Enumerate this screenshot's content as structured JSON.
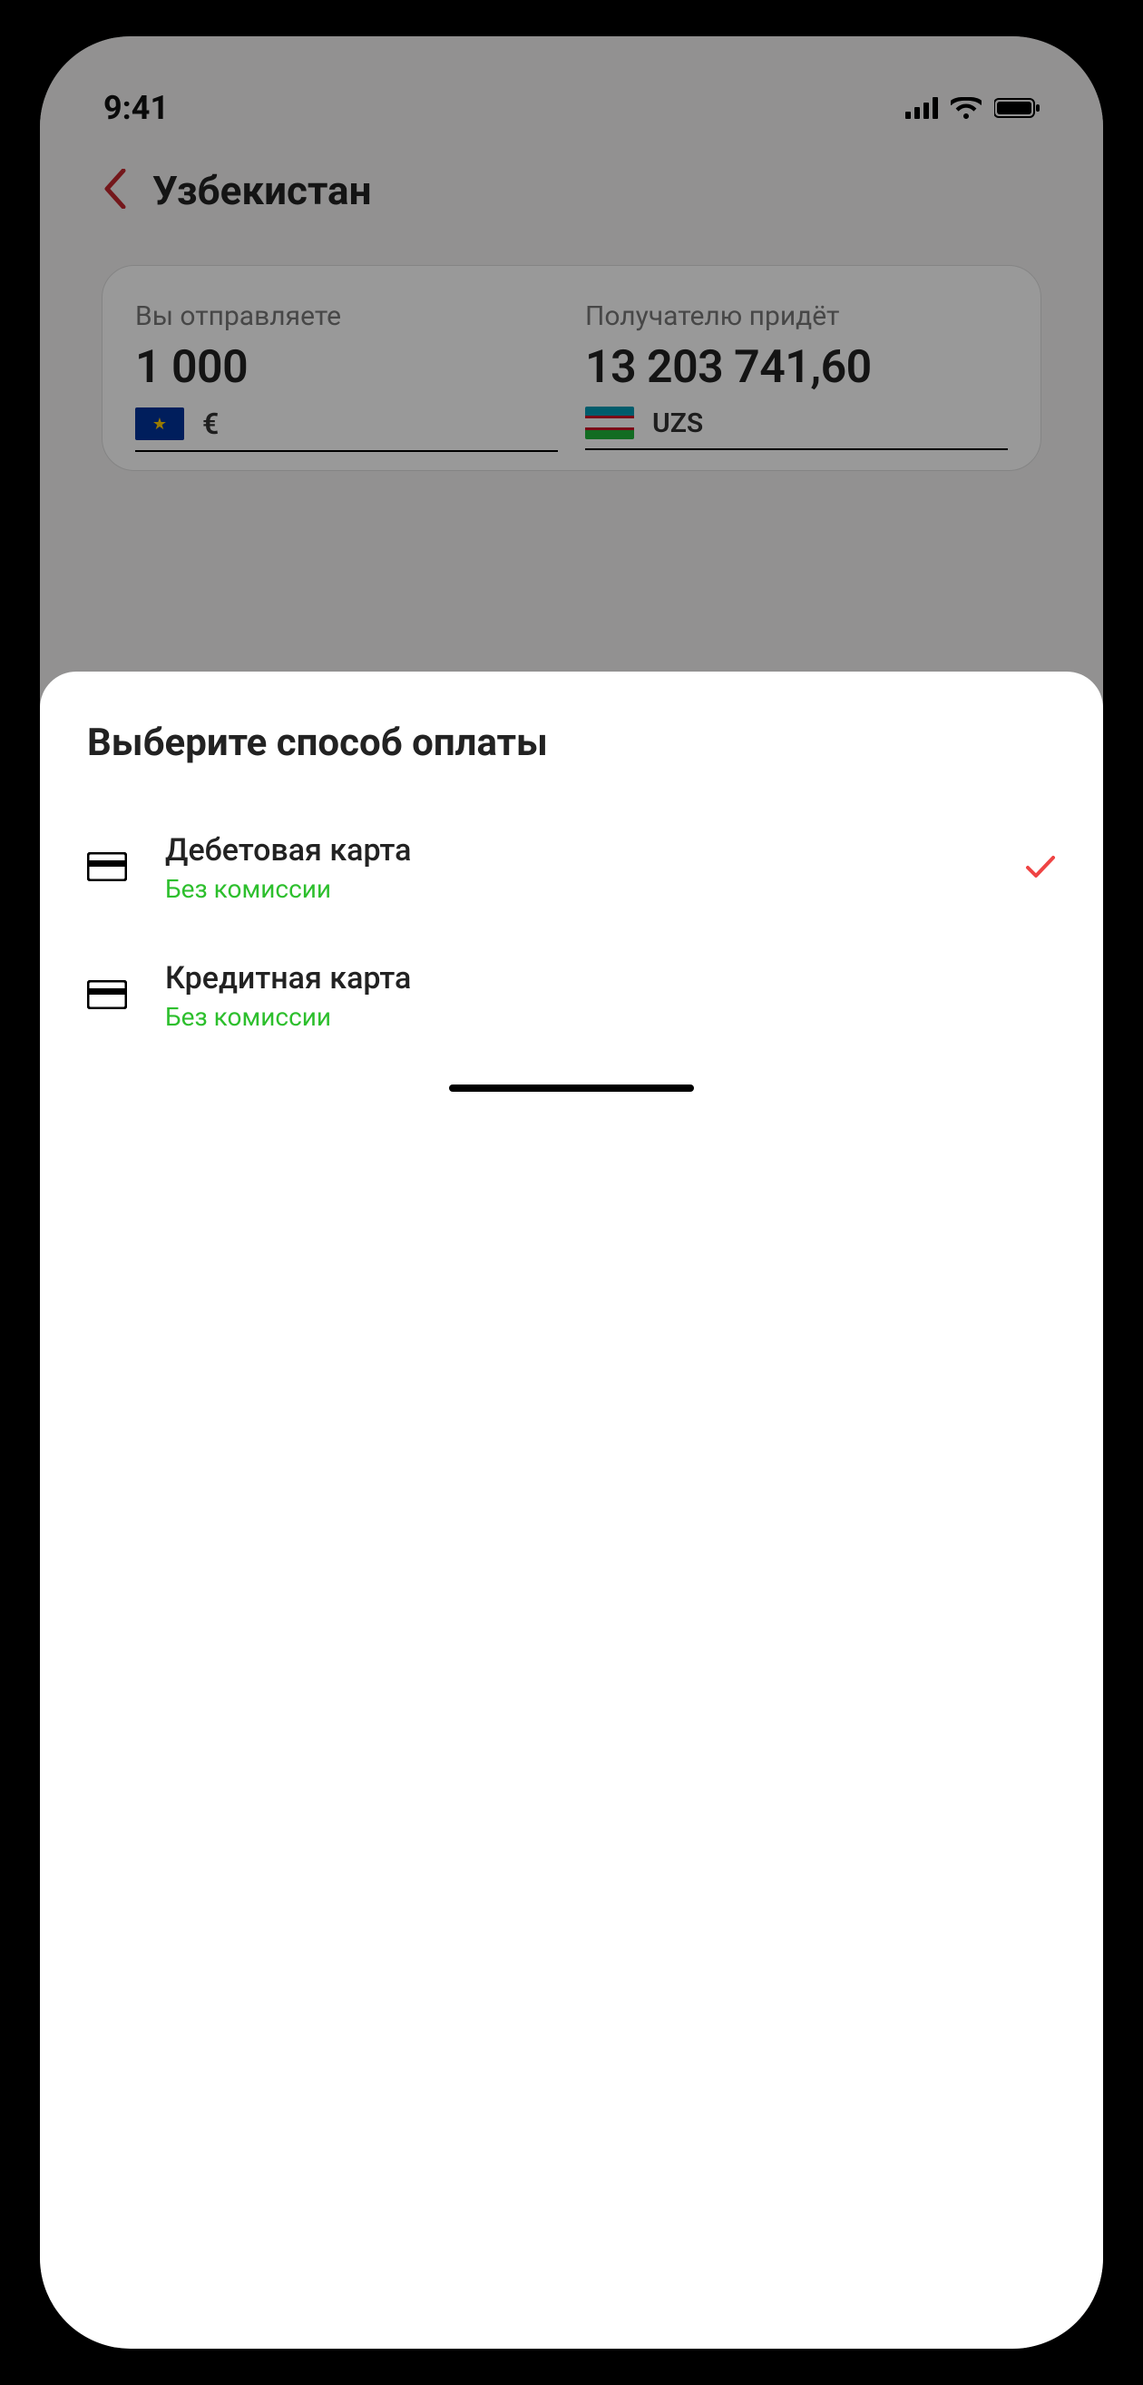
{
  "status": {
    "time": "9:41"
  },
  "nav": {
    "title": "Узбекистан"
  },
  "send": {
    "label": "Вы отправляете",
    "amount": "1 000",
    "currencySymbol": "€"
  },
  "receive": {
    "label": "Получателю придёт",
    "amount": "13 203 741,60",
    "currencyCode": "UZS"
  },
  "sheet": {
    "title": "Выберите способ оплаты",
    "options": [
      {
        "title": "Дебетовая карта",
        "subtitle": "Без комиссии",
        "selected": true
      },
      {
        "title": "Кредитная карта",
        "subtitle": "Без комиссии",
        "selected": false
      }
    ]
  }
}
